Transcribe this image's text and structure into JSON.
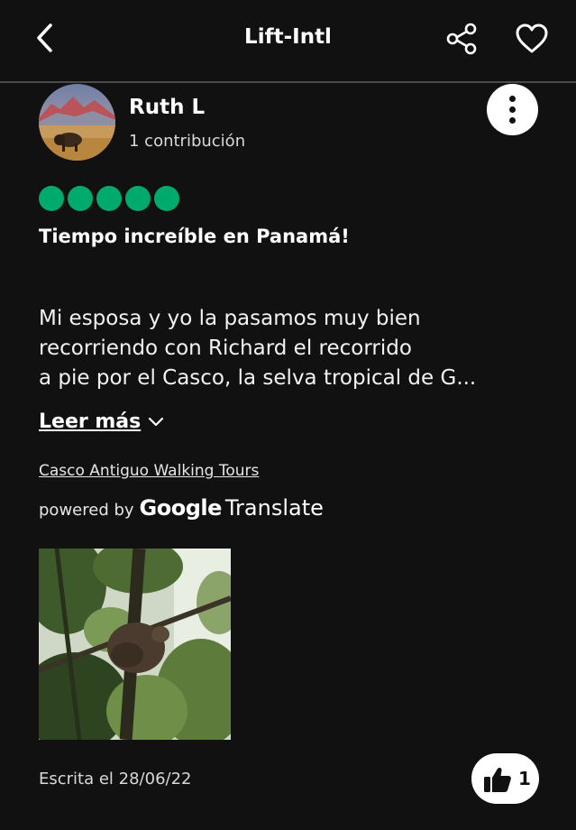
{
  "header": {
    "title": "Lift-Intl",
    "back_icon": "chevron-left-icon",
    "share_icon": "share-icon",
    "favorite_icon": "heart-icon"
  },
  "reviewer": {
    "name": "Ruth L",
    "contributions": "1 contribución",
    "avatar": "bison-landscape-photo"
  },
  "review": {
    "rating": 5,
    "rating_color": "#00aa6c",
    "title": "Tiempo increíble en Panamá!",
    "body_lines": [
      "Mi esposa y yo la pasamos muy bien",
      "recorriendo con Richard el recorrido",
      "a pie por el Casco, la selva tropical de G..."
    ],
    "read_more": "Leer más",
    "tour_link": "Casco Antiguo Walking Tours",
    "powered_by": "powered by",
    "translate_brand": "Google",
    "translate_product": "Translate",
    "photo": "sloth-in-rainforest-photo",
    "written_date": "Escrita el 28/06/22",
    "likes": "1"
  }
}
